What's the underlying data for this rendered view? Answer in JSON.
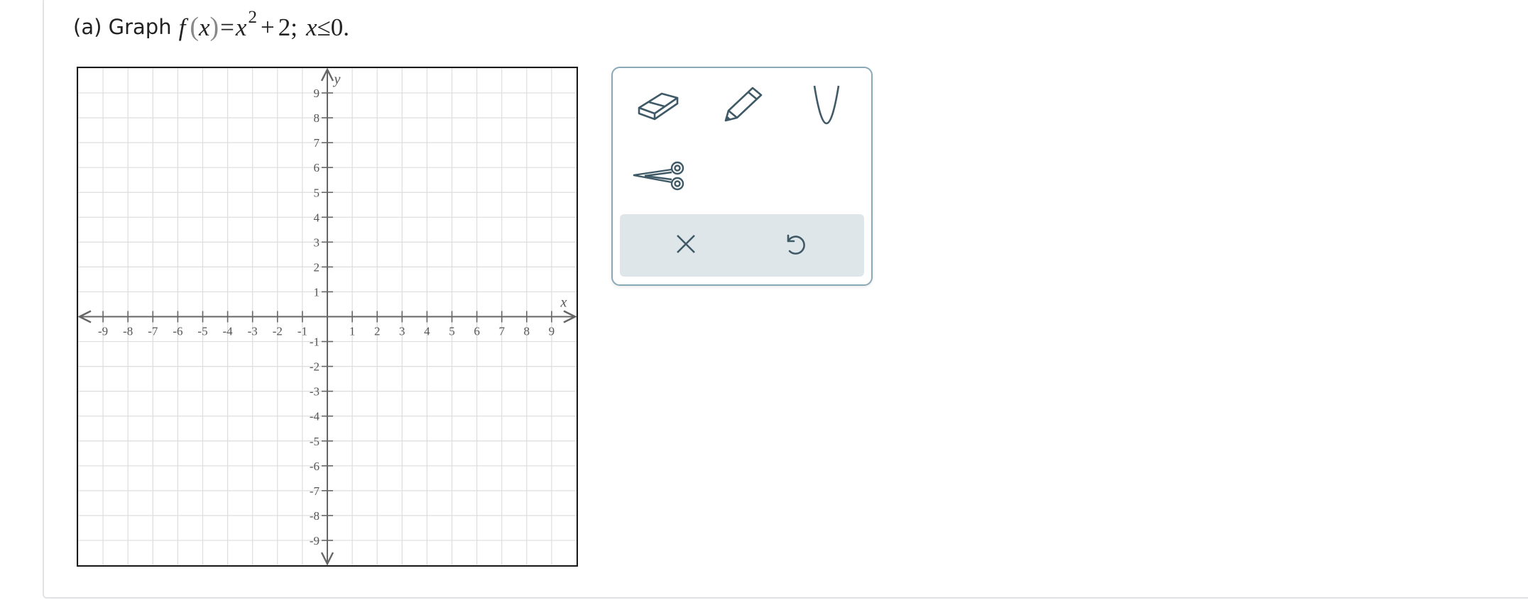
{
  "question": {
    "prefix": "(a) Graph",
    "fn": "f",
    "paren_open": "(",
    "var": "x",
    "paren_close": ")",
    "equals": "=",
    "base": "x",
    "exponent": "2",
    "rest_plus": "+",
    "rest_num": "2;",
    "cond_var": "x",
    "cond_op": "≤",
    "cond_val": "0."
  },
  "chart_data": {
    "type": "scatter",
    "xlabel": "x",
    "ylabel": "y",
    "xlim": [
      -10,
      10
    ],
    "ylim": [
      -10,
      10
    ],
    "x_ticks": [
      -9,
      -8,
      -7,
      -6,
      -5,
      -4,
      -3,
      -2,
      -1,
      1,
      2,
      3,
      4,
      5,
      6,
      7,
      8,
      9
    ],
    "y_ticks": [
      -9,
      -8,
      -7,
      -6,
      -5,
      -4,
      -3,
      -2,
      -1,
      1,
      2,
      3,
      4,
      5,
      6,
      7,
      8,
      9
    ],
    "grid": true,
    "series": []
  },
  "tools": {
    "eraser": "eraser-icon",
    "pencil": "pencil-icon",
    "parabola": "parabola-icon",
    "scissors": "scissors-icon",
    "clear": "close-icon",
    "undo": "undo-icon"
  },
  "colors": {
    "icon": "#3f5a66",
    "grid": "#dddddd",
    "axis": "#666666",
    "panel_border": "#8aa9b7",
    "bar_bg": "#dfe6e9"
  }
}
